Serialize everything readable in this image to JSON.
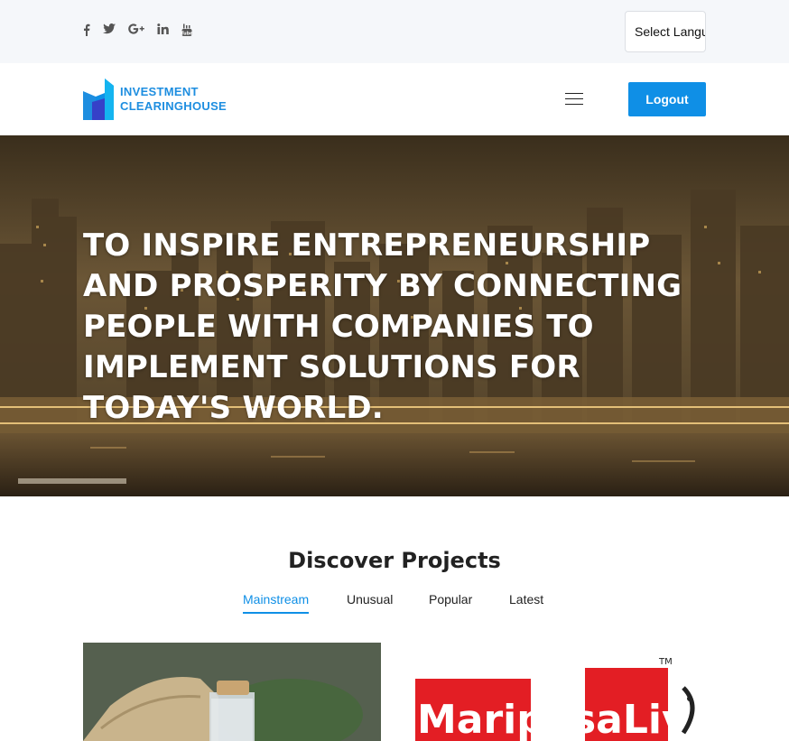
{
  "social": {
    "icons": [
      "facebook-icon",
      "twitter-icon",
      "google-plus-icon",
      "linkedin-icon",
      "youtube-icon"
    ]
  },
  "language": {
    "select_label": "Select Language"
  },
  "header": {
    "logo_line1": "INVESTMENT",
    "logo_line2": "CLEARINGHOUSE",
    "logout_label": "Logout"
  },
  "hero": {
    "headline": "TO INSPIRE ENTREPRENEURSHIP AND PROSPERITY BY CONNECTING PEOPLE WITH COMPANIES TO IMPLEMENT SOLUTIONS FOR TODAY'S WORLD."
  },
  "discover": {
    "title": "Discover Projects",
    "tabs": [
      "Mainstream",
      "Unusual",
      "Popular",
      "Latest"
    ],
    "active_tab": "Mainstream"
  },
  "cards": [
    {
      "image": "cbd-oil-jar-image"
    },
    {
      "image": "mariposa-live-media-logo",
      "logo_text": "MariposaLiveMedia"
    }
  ],
  "colors": {
    "accent": "#0f8fe6",
    "topbar_bg": "#f5f7fa",
    "logo_blue": "#1e8ee0"
  }
}
